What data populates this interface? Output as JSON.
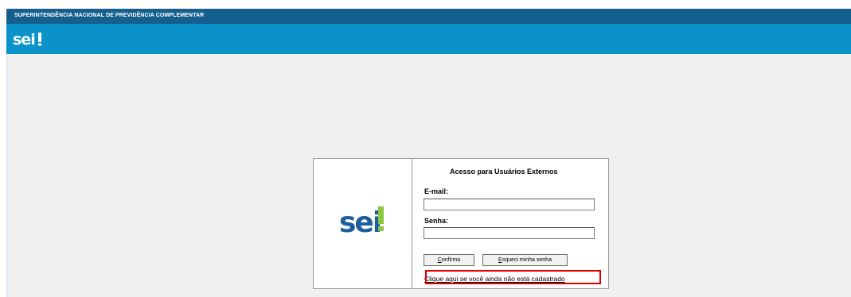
{
  "header": {
    "org_title": "SUPERINTENDÊNCIA NACIONAL DE PREVIDÊNCIA COMPLEMENTAR",
    "logo_text": "sei!"
  },
  "login": {
    "logo_text": "sei!",
    "title": "Acesso para Usuários Externos",
    "email_label": "E-mail:",
    "email_value": "",
    "password_label": "Senha:",
    "password_value": "",
    "confirm_accesskey": "C",
    "confirm_rest": "onfirma",
    "forgot_accesskey": "E",
    "forgot_rest": "squeci minha senha",
    "register_link": "Clique aqui se você ainda não está cadastrado"
  },
  "colors": {
    "top_bar": "#155f8e",
    "banner": "#0b93c9",
    "content_bg": "#f0f0f0",
    "logo_blue": "#1a5e9a",
    "logo_green": "#8dc63f",
    "highlight": "#e00000"
  }
}
